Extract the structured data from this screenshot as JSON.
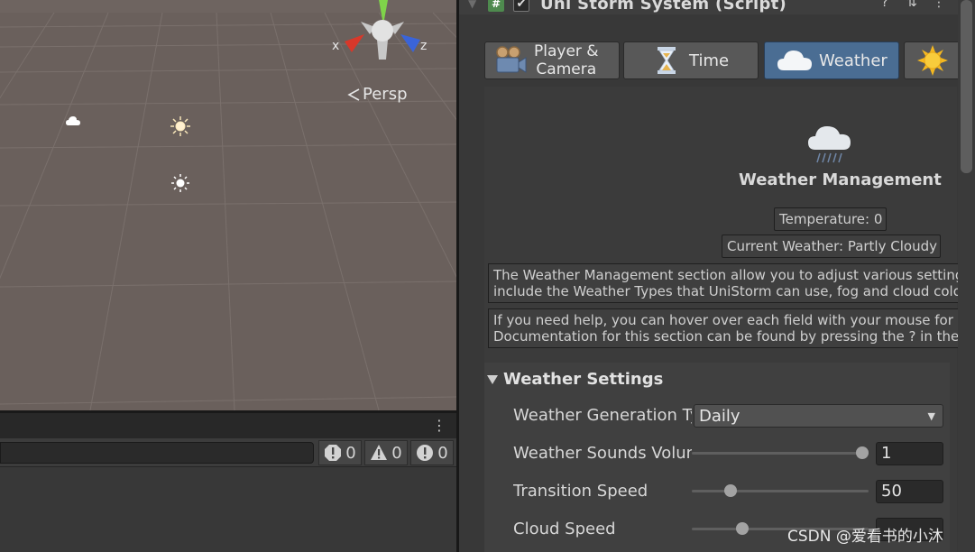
{
  "scene": {
    "gizmo": {
      "x_label": "x",
      "z_label": "z"
    },
    "persp_label": "Persp",
    "colors": {
      "ground": "#6a605c",
      "x_axis": "#d8382a",
      "z_axis": "#3a64d8",
      "y_axis": "#7fd34a"
    }
  },
  "console": {
    "menu_icon": "kebab-menu-icon",
    "counts": {
      "errors": "0",
      "warnings": "0",
      "messages": "0"
    }
  },
  "component": {
    "title": "Uni Storm System (Script)",
    "script_glyph": "#",
    "enabled_glyph": "✔",
    "tools": [
      "?",
      "⇅",
      "⋮"
    ]
  },
  "tabs": [
    {
      "label_line1": "Player &",
      "label_line2": "Camera",
      "icon": "camera-icon"
    },
    {
      "label": "Time",
      "icon": "hourglass-icon"
    },
    {
      "label": "Weather",
      "icon": "cloud-icon",
      "active": true
    },
    {
      "label": "",
      "icon": "sun-icon"
    }
  ],
  "weather": {
    "title": "Weather Management",
    "temperature": "Temperature: 0",
    "current": "Current Weather: Partly Cloudy",
    "help1_line1": "The Weather Management section allow you to adjust various settings",
    "help1_line2": "include the Weather Types that UniStorm can use, fog and cloud color",
    "help2_line1": "If you need help, you can hover over each field with your mouse for a",
    "help2_line2": "Documentation for this section can be found by pressing the ? in the u"
  },
  "settings": {
    "header": "Weather Settings",
    "fields": {
      "generation_label": "Weather Generation Ty",
      "generation_value": "Daily",
      "sounds_label": "Weather Sounds Volun",
      "sounds_value": "1",
      "transition_label": "Transition Speed",
      "transition_value": "50",
      "cloud_label": "Cloud Speed"
    },
    "slider_levels": {
      "sounds": 1.0,
      "transition": 0.2,
      "cloud": 0.27
    }
  },
  "watermark": "CSDN @爱看书的小沐"
}
